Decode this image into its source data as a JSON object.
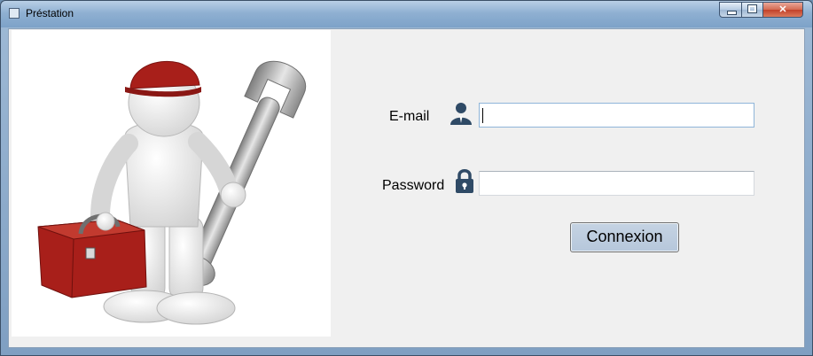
{
  "window": {
    "title": "Préstation"
  },
  "form": {
    "email_label": "E-mail",
    "email_value": "",
    "password_label": "Password",
    "password_value": "",
    "submit_label": "Connexion"
  },
  "colors": {
    "accent": "#2f4a66",
    "button_face": "#bccbdd",
    "toolbox_red": "#a81f1a"
  }
}
